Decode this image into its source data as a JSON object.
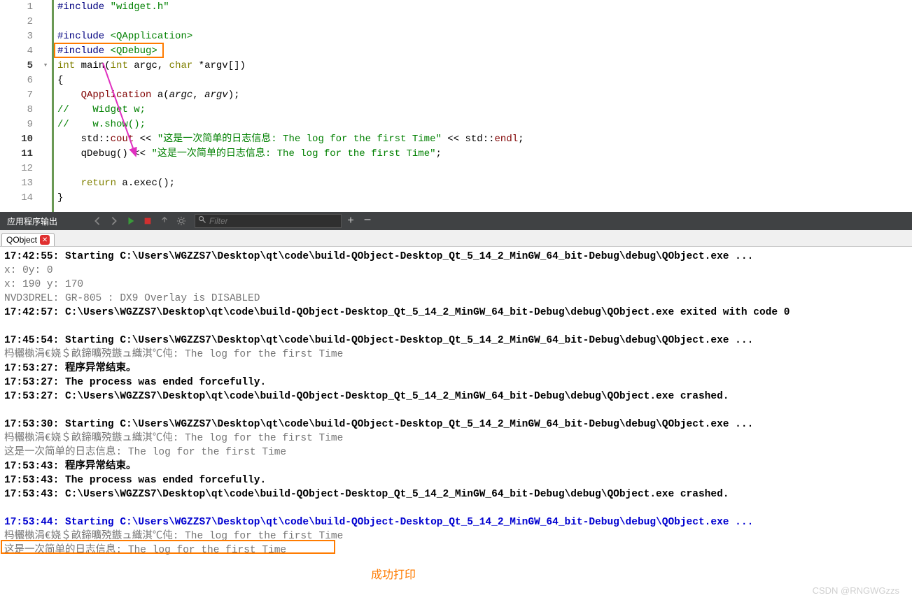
{
  "editor": {
    "lines": [
      {
        "n": "1",
        "html": "<span class='kw-navy'>#include</span> <span class='str-green'>\"widget.h\"</span>"
      },
      {
        "n": "2",
        "html": ""
      },
      {
        "n": "3",
        "html": "<span class='kw-navy'>#include</span> <span class='str-green'>&lt;QApplication&gt;</span>"
      },
      {
        "n": "4",
        "html": "<span class='kw-navy'>#include</span> <span class='str-green'>&lt;QDebug&gt;</span>"
      },
      {
        "n": "5",
        "bold": true,
        "fold": "▾",
        "html": "<span class='kw-olive'>int</span> <span class='ident'>main</span>(<span class='kw-olive'>int</span> argc, <span class='kw-olive'>char</span> *argv[])"
      },
      {
        "n": "6",
        "html": "{"
      },
      {
        "n": "7",
        "html": "    <span class='str-red'>QApplication</span> <span class='ident'>a</span>(<span class='italic'>argc</span>, <span class='italic'>argv</span>);"
      },
      {
        "n": "8",
        "html": "<span class='comment'>//    Widget w;</span>"
      },
      {
        "n": "9",
        "html": "<span class='comment'>//    w.show();</span>"
      },
      {
        "n": "10",
        "bold": true,
        "html": "    std::<span class='str-red'>cout</span> &lt;&lt; <span class='str-green'>\"这是一次简单的日志信息: The log for the first Time\"</span> &lt;&lt; std::<span class='str-red'>endl</span>;"
      },
      {
        "n": "11",
        "bold": true,
        "html": "    <span class='ident'>qDebug</span>() &lt;&lt; <span class='str-green'>\"这是一次简单的日志信息: The log for the first Time\"</span>;"
      },
      {
        "n": "12",
        "html": ""
      },
      {
        "n": "13",
        "html": "    <span class='kw-olive'>return</span> a.exec();"
      },
      {
        "n": "14",
        "html": "}"
      }
    ]
  },
  "panel": {
    "title": "应用程序输出",
    "filter_placeholder": "Filter",
    "tab_label": "QObject"
  },
  "output_lines": [
    {
      "cls": "bold",
      "text": "17:42:55: Starting C:\\Users\\WGZZS7\\Desktop\\qt\\code\\build-QObject-Desktop_Qt_5_14_2_MinGW_64_bit-Debug\\debug\\QObject.exe ..."
    },
    {
      "cls": "gray",
      "text": "x: 0y: 0"
    },
    {
      "cls": "gray",
      "text": "x: 190 y: 170"
    },
    {
      "cls": "gray",
      "text": "NVD3DREL: GR-805 : DX9 Overlay is DISABLED"
    },
    {
      "cls": "bold",
      "text": "17:42:57: C:\\Users\\WGZZS7\\Desktop\\qt\\code\\build-QObject-Desktop_Qt_5_14_2_MinGW_64_bit-Debug\\debug\\QObject.exe exited with code 0"
    },
    {
      "cls": "",
      "text": " "
    },
    {
      "cls": "bold",
      "text": "17:45:54: Starting C:\\Users\\WGZZS7\\Desktop\\qt\\code\\build-QObject-Desktop_Qt_5_14_2_MinGW_64_bit-Debug\\debug\\QObject.exe ..."
    },
    {
      "cls": "gray",
      "text": "杩欐槸涓€娆＄畝鍗曠殑鏃ュ織淇℃伅: The log for the first Time"
    },
    {
      "cls": "bold",
      "text": "17:53:27: 程序异常结束。"
    },
    {
      "cls": "bold",
      "text": "17:53:27: The process was ended forcefully."
    },
    {
      "cls": "bold",
      "text": "17:53:27: C:\\Users\\WGZZS7\\Desktop\\qt\\code\\build-QObject-Desktop_Qt_5_14_2_MinGW_64_bit-Debug\\debug\\QObject.exe crashed."
    },
    {
      "cls": "",
      "text": " "
    },
    {
      "cls": "bold",
      "text": "17:53:30: Starting C:\\Users\\WGZZS7\\Desktop\\qt\\code\\build-QObject-Desktop_Qt_5_14_2_MinGW_64_bit-Debug\\debug\\QObject.exe ..."
    },
    {
      "cls": "gray",
      "text": "杩欐槸涓€娆＄畝鍗曠殑鏃ュ織淇℃伅: The log for the first Time"
    },
    {
      "cls": "gray",
      "text": "这是一次简单的日志信息: The log for the first Time"
    },
    {
      "cls": "bold",
      "text": "17:53:43: 程序异常结束。"
    },
    {
      "cls": "bold",
      "text": "17:53:43: The process was ended forcefully."
    },
    {
      "cls": "bold",
      "text": "17:53:43: C:\\Users\\WGZZS7\\Desktop\\qt\\code\\build-QObject-Desktop_Qt_5_14_2_MinGW_64_bit-Debug\\debug\\QObject.exe crashed."
    },
    {
      "cls": "",
      "text": " "
    },
    {
      "cls": "blue-bold",
      "text": "17:53:44: Starting C:\\Users\\WGZZS7\\Desktop\\qt\\code\\build-QObject-Desktop_Qt_5_14_2_MinGW_64_bit-Debug\\debug\\QObject.exe ..."
    },
    {
      "cls": "gray",
      "text": "杩欐槸涓€娆＄畝鍗曠殑鏃ュ織淇℃伅: The log for the first Time"
    },
    {
      "cls": "gray",
      "text": "这是一次简单的日志信息: The log for the first Time"
    }
  ],
  "annotation_text": "成功打印",
  "watermark": "CSDN @RNGWGzzs"
}
